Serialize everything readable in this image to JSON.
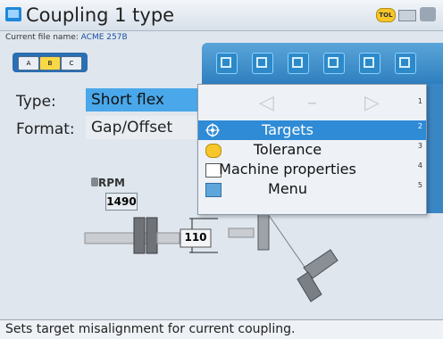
{
  "window": {
    "title": "Coupling 1 type",
    "tolerance_badge": "TOL"
  },
  "file": {
    "prefix": "Current file name:",
    "name": "ACME 257B"
  },
  "segmented": {
    "labels": [
      "A",
      "B",
      "C"
    ]
  },
  "form": {
    "type_label": "Type:",
    "type_value": "Short flex",
    "format_label": "Format:",
    "format_value": "Gap/Offset"
  },
  "toolbar": {
    "icons": [
      "machine-layout-icon",
      "coupling-icon",
      "measure-icon",
      "results-icon",
      "trend-icon",
      "flip-icon"
    ]
  },
  "popup": {
    "items": [
      {
        "label": "Targets",
        "num": "2",
        "selected": true,
        "icon": "target-icon"
      },
      {
        "label": "Tolerance",
        "num": "3",
        "selected": false,
        "icon": "tolerance-icon"
      },
      {
        "label": "Machine properties",
        "num": "4",
        "selected": false,
        "icon": "machine-properties-icon"
      },
      {
        "label": "Menu",
        "num": "5",
        "selected": false,
        "icon": "menu-icon"
      }
    ],
    "nav_num": "1"
  },
  "diagram": {
    "rpm_label": "RPM",
    "rpm_value": "1490",
    "dimension_value": "110"
  },
  "status": {
    "text": "Sets target misalignment for current coupling."
  },
  "colors": {
    "accent": "#2f8bd6",
    "toolbar": "#3a86c5",
    "field_highlight": "#4aa8ea"
  }
}
